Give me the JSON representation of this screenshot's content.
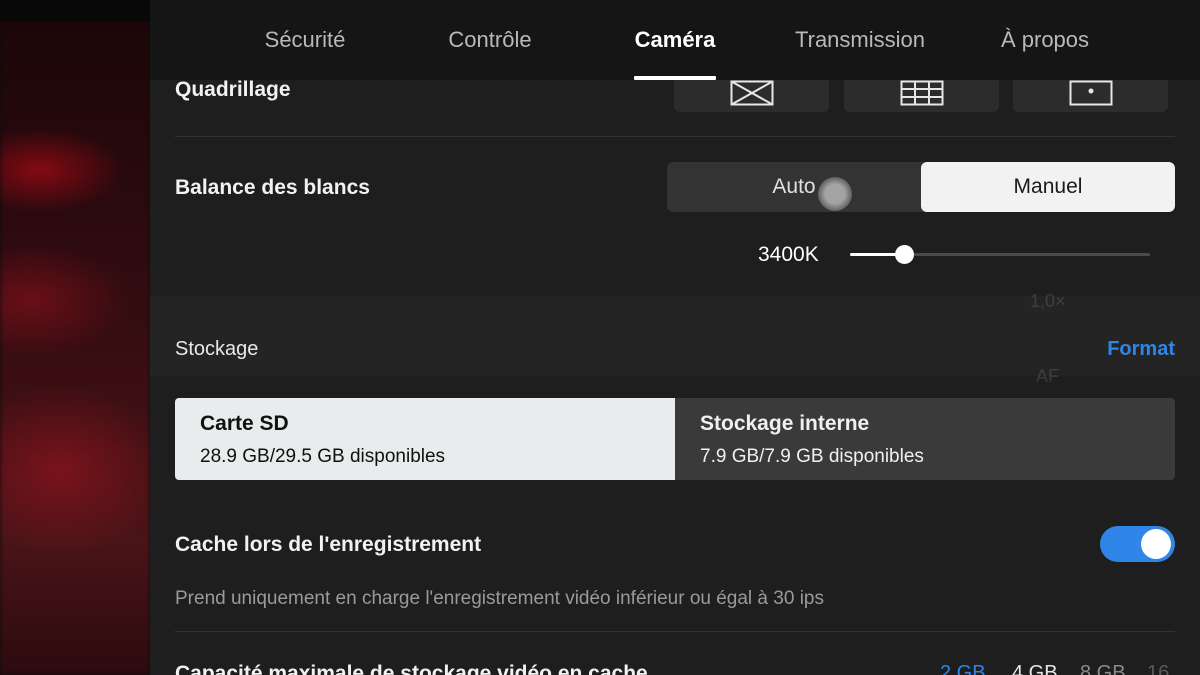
{
  "tabs": [
    {
      "label": "Sécurité"
    },
    {
      "label": "Contrôle"
    },
    {
      "label": "Caméra",
      "active": true
    },
    {
      "label": "Transmission"
    },
    {
      "label": "À propos"
    }
  ],
  "grid": {
    "title": "Quadrillage",
    "options": [
      {
        "icon": "grid-diagonal-icon"
      },
      {
        "icon": "grid-lines-icon"
      },
      {
        "icon": "grid-center-point-icon"
      }
    ]
  },
  "white_balance": {
    "title": "Balance des blancs",
    "options": [
      "Auto",
      "Manuel"
    ],
    "selected": "Manuel",
    "value_label": "3400K",
    "slider_fraction": 0.18
  },
  "overlay_ghost": {
    "zoom": "1,0×",
    "focus": "AF"
  },
  "storage": {
    "label": "Stockage",
    "format_label": "Format",
    "sd_card": {
      "name": "Carte SD",
      "capacity": "28.9 GB/29.5 GB disponibles",
      "selected": true
    },
    "internal": {
      "name": "Stockage interne",
      "capacity": "7.9 GB/7.9 GB disponibles",
      "selected": false
    }
  },
  "cache": {
    "title": "Cache lors de l'enregistrement",
    "enabled": true,
    "description": "Prend uniquement en charge l'enregistrement vidéo inférieur ou égal à 30 ips"
  },
  "max_cache": {
    "title": "Capacité maximale de stockage vidéo en cache",
    "options": [
      "2 GB",
      "4 GB",
      "8 GB",
      "16"
    ],
    "selected": "2 GB"
  },
  "colors": {
    "accent": "#2f86e8",
    "panel": "#1e1e1e",
    "tabbar": "#151515"
  }
}
